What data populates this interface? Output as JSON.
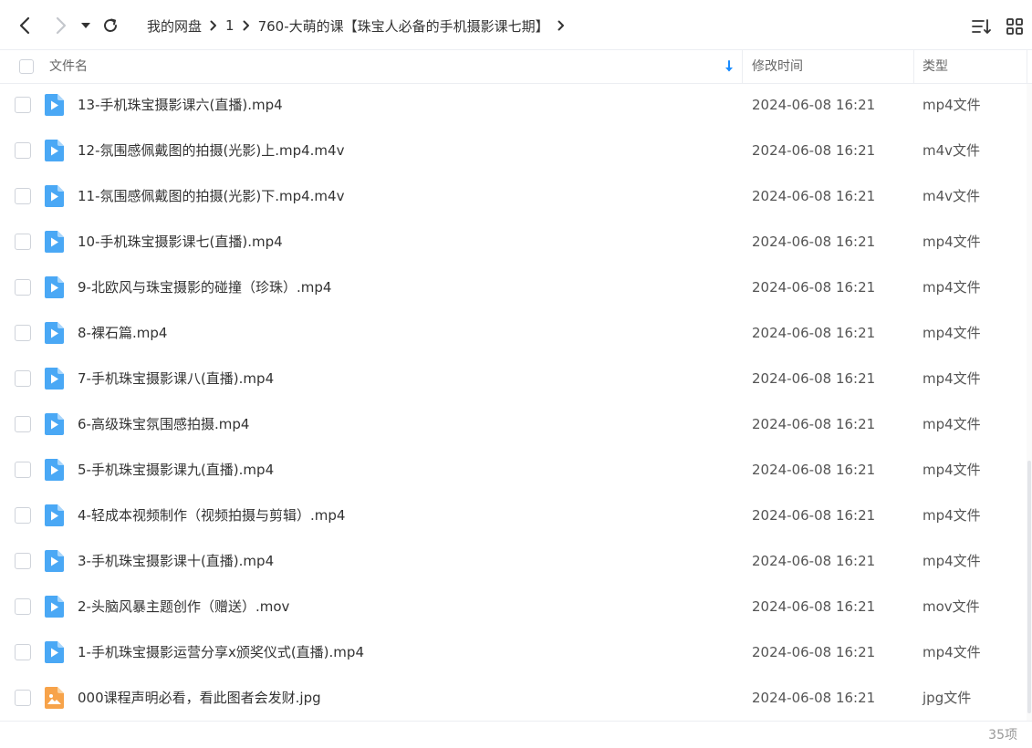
{
  "breadcrumb": [
    {
      "label": "我的网盘"
    },
    {
      "label": "1"
    },
    {
      "label": "760-大萌的课【珠宝人必备的手机摄影课七期】"
    }
  ],
  "header": {
    "name_label": "文件名",
    "time_label": "修改时间",
    "type_label": "类型"
  },
  "files": [
    {
      "name": "13-手机珠宝摄影课六(直播).mp4",
      "time": "2024-06-08 16:21",
      "type": "mp4文件",
      "icon": "video-file-icon"
    },
    {
      "name": "12-氛围感佩戴图的拍摄(光影)上.mp4.m4v",
      "time": "2024-06-08 16:21",
      "type": "m4v文件",
      "icon": "video-file-icon"
    },
    {
      "name": "11-氛围感佩戴图的拍摄(光影)下.mp4.m4v",
      "time": "2024-06-08 16:21",
      "type": "m4v文件",
      "icon": "video-file-icon"
    },
    {
      "name": "10-手机珠宝摄影课七(直播).mp4",
      "time": "2024-06-08 16:21",
      "type": "mp4文件",
      "icon": "video-file-icon"
    },
    {
      "name": "9-北欧风与珠宝摄影的碰撞（珍珠）.mp4",
      "time": "2024-06-08 16:21",
      "type": "mp4文件",
      "icon": "video-file-icon"
    },
    {
      "name": "8-裸石篇.mp4",
      "time": "2024-06-08 16:21",
      "type": "mp4文件",
      "icon": "video-file-icon"
    },
    {
      "name": "7-手机珠宝摄影课八(直播).mp4",
      "time": "2024-06-08 16:21",
      "type": "mp4文件",
      "icon": "video-file-icon"
    },
    {
      "name": "6-高级珠宝氛围感拍摄.mp4",
      "time": "2024-06-08 16:21",
      "type": "mp4文件",
      "icon": "video-file-icon"
    },
    {
      "name": "5-手机珠宝摄影课九(直播).mp4",
      "time": "2024-06-08 16:21",
      "type": "mp4文件",
      "icon": "video-file-icon"
    },
    {
      "name": "4-轻成本视频制作（视频拍摄与剪辑）.mp4",
      "time": "2024-06-08 16:21",
      "type": "mp4文件",
      "icon": "video-file-icon"
    },
    {
      "name": "3-手机珠宝摄影课十(直播).mp4",
      "time": "2024-06-08 16:21",
      "type": "mp4文件",
      "icon": "video-file-icon"
    },
    {
      "name": "2-头脑风暴主题创作（赠送）.mov",
      "time": "2024-06-08 16:21",
      "type": "mov文件",
      "icon": "video-file-icon"
    },
    {
      "name": "1-手机珠宝摄影运营分享x颁奖仪式(直播).mp4",
      "time": "2024-06-08 16:21",
      "type": "mp4文件",
      "icon": "video-file-icon"
    },
    {
      "name": "000课程声明必看，看此图者会发财.jpg",
      "time": "2024-06-08 16:21",
      "type": "jpg文件",
      "icon": "image-file-icon"
    }
  ],
  "footer": {
    "count": "35项"
  },
  "colors": {
    "video_icon": "#4aa8f5",
    "image_icon": "#f7a34a",
    "sort_arrow": "#1a8cff"
  }
}
